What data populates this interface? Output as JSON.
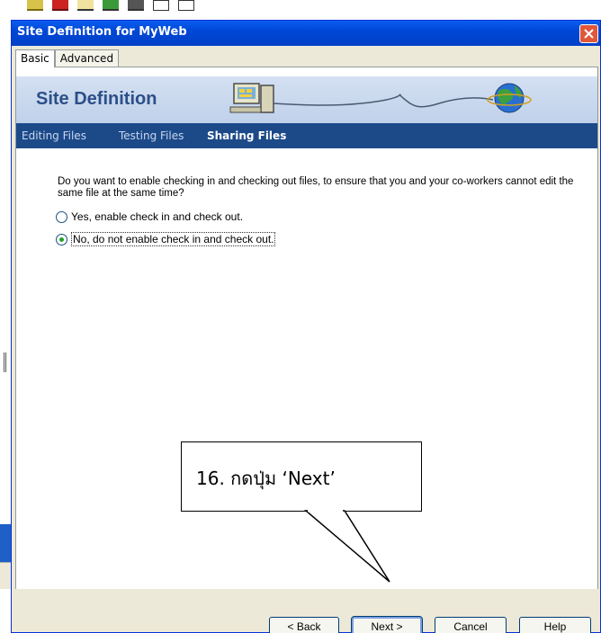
{
  "window": {
    "title": "Site Definition for MyWeb",
    "close_icon": "close-icon"
  },
  "tabs": [
    {
      "label": "Basic",
      "active": true
    },
    {
      "label": "Advanced",
      "active": false
    }
  ],
  "banner": {
    "title": "Site Definition"
  },
  "steps": [
    {
      "label": "Editing Files",
      "active": false
    },
    {
      "label": "Testing Files",
      "active": false
    },
    {
      "label": "Sharing Files",
      "active": true
    }
  ],
  "question": "Do you want to enable checking in and checking out files, to ensure that you and your co-workers cannot edit the same file at the same time?",
  "options": [
    {
      "label": "Yes, enable check in and check out.",
      "checked": false
    },
    {
      "label": "No, do not enable check in and check out.",
      "checked": true
    }
  ],
  "callout": {
    "text": "16. กดปุ่ม ‘Next’"
  },
  "buttons": {
    "back": "< Back",
    "next": "Next >",
    "cancel": "Cancel",
    "help": "Help"
  },
  "colors": {
    "titlebar": "#0047d6",
    "banner": "#bfd1ea",
    "subnav": "#1c4a89",
    "dialog_bg": "#ece9d8"
  }
}
